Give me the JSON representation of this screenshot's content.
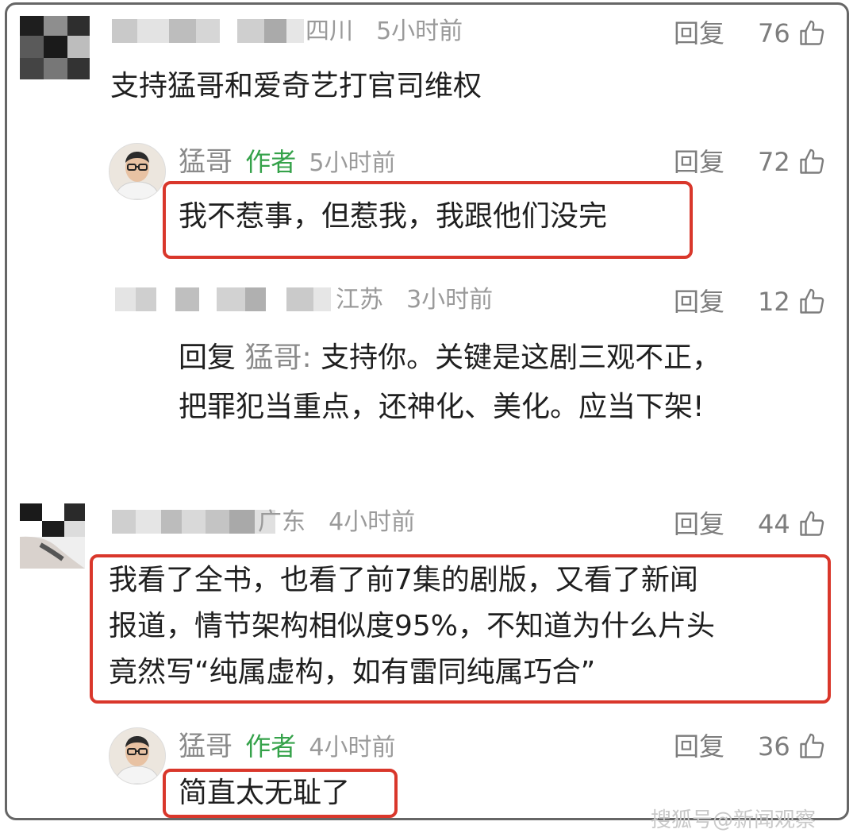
{
  "comments": [
    {
      "location": "四川",
      "time": "5小时前",
      "reply_label": "回复",
      "likes": "76",
      "text": "支持猛哥和爱奇艺打官司维权",
      "replies": [
        {
          "name": "猛哥",
          "author_tag": "作者",
          "time": "5小时前",
          "reply_label": "回复",
          "likes": "72",
          "text": "我不惹事，但惹我，我跟他们没完"
        },
        {
          "location": "江苏",
          "time": "3小时前",
          "reply_label": "回复",
          "likes": "12",
          "reply_prefix": "回复",
          "reply_to": "猛哥:",
          "lines": [
            "支持你。关键是这剧三观不正，",
            "把罪犯当重点，还神化、美化。应当下架!"
          ]
        }
      ]
    },
    {
      "location": "广东",
      "time": "4小时前",
      "reply_label": "回复",
      "likes": "44",
      "lines": [
        "我看了全书，也看了前7集的剧版，又看了新闻",
        "报道，情节架构相似度95%，不知道为什么片头",
        "竟然写“纯属虚构，如有雷同纯属巧合”"
      ],
      "replies": [
        {
          "name": "猛哥",
          "author_tag": "作者",
          "time": "4小时前",
          "reply_label": "回复",
          "likes": "36",
          "text": "简直太无耻了"
        }
      ]
    }
  ],
  "watermark": "搜狐号@新闻观察",
  "colors": {
    "highlight_border": "#d9372b",
    "author_tag": "#35a24a",
    "meta_gray": "#9a9a9a",
    "frame_border": "#666666"
  },
  "icons": {
    "like": "thumbs-up-icon"
  }
}
